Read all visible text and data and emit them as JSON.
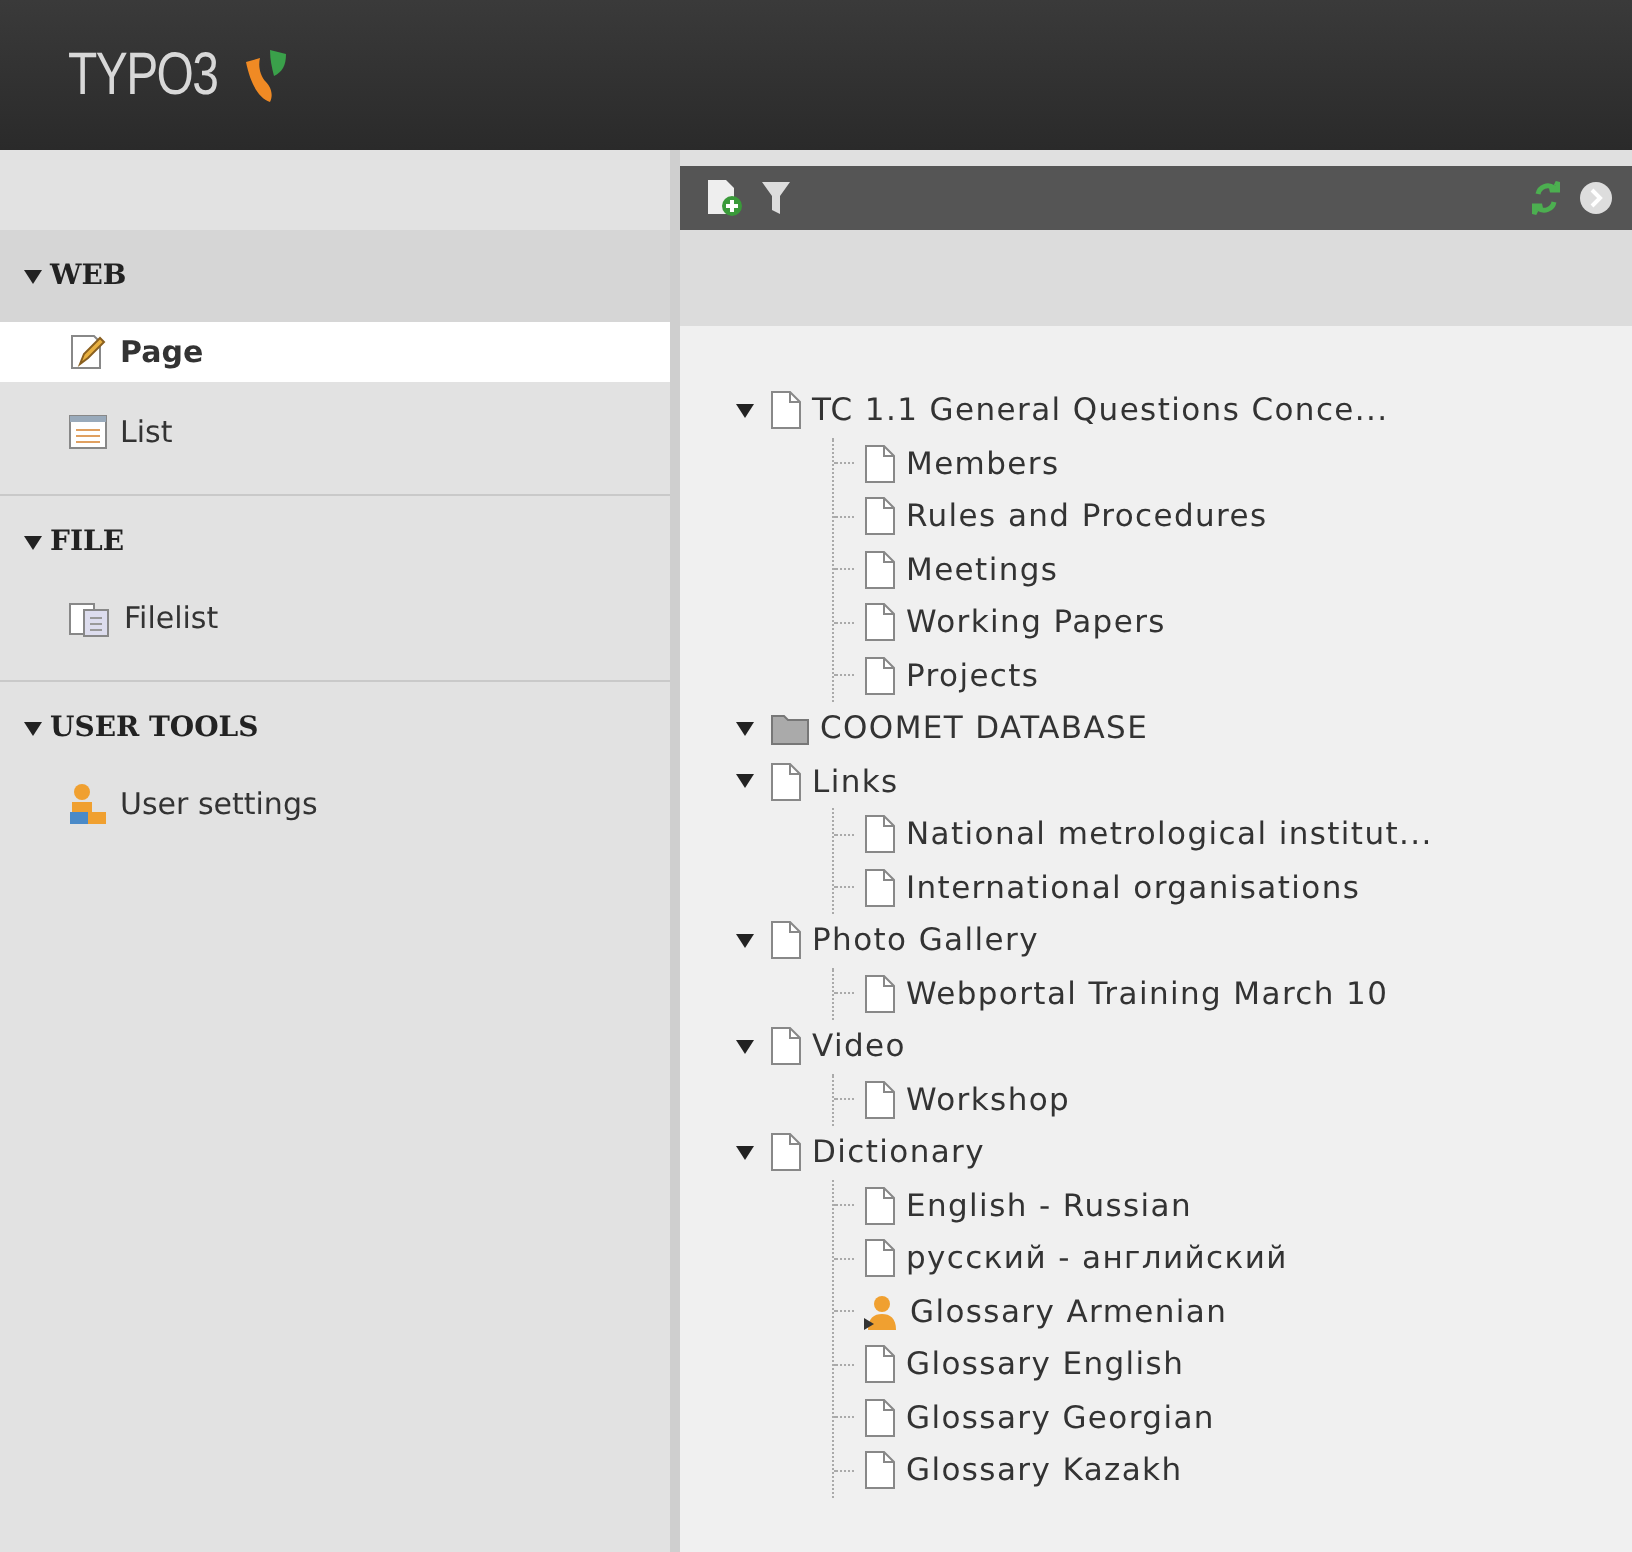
{
  "header": {
    "logo": "TYPO3"
  },
  "sidebar": {
    "groups": [
      {
        "title": "WEB",
        "expanded": true,
        "items": [
          {
            "label": "Page",
            "kind": "page-edit",
            "selected": true
          },
          {
            "label": "List",
            "kind": "list",
            "selected": false
          }
        ]
      },
      {
        "title": "FILE",
        "expanded": true,
        "items": [
          {
            "label": "Filelist",
            "kind": "filelist",
            "selected": false
          }
        ]
      },
      {
        "title": "USER TOOLS",
        "expanded": true,
        "items": [
          {
            "label": "User settings",
            "kind": "user",
            "selected": false
          }
        ]
      }
    ]
  },
  "tree": [
    {
      "label": "TC 1.1 General Questions Conce...",
      "kind": "page",
      "expanded": true,
      "children": [
        {
          "label": "Members",
          "kind": "page"
        },
        {
          "label": "Rules and Procedures",
          "kind": "page"
        },
        {
          "label": "Meetings",
          "kind": "page"
        },
        {
          "label": "Working Papers",
          "kind": "page"
        },
        {
          "label": "Projects",
          "kind": "page"
        }
      ]
    },
    {
      "label": "COOMET DATABASE",
      "kind": "folder",
      "expanded": true
    },
    {
      "label": "Links",
      "kind": "page",
      "expanded": true,
      "children": [
        {
          "label": "National metrological institut...",
          "kind": "page"
        },
        {
          "label": "International organisations",
          "kind": "page"
        }
      ]
    },
    {
      "label": "Photo Gallery",
      "kind": "page",
      "expanded": true,
      "children": [
        {
          "label": "Webportal Training March 10",
          "kind": "page"
        }
      ]
    },
    {
      "label": "Video",
      "kind": "page",
      "expanded": true,
      "children": [
        {
          "label": "Workshop",
          "kind": "page"
        }
      ]
    },
    {
      "label": "Dictionary",
      "kind": "page",
      "expanded": true,
      "children": [
        {
          "label": "English - Russian",
          "kind": "page"
        },
        {
          "label": "русский - английский",
          "kind": "page"
        },
        {
          "label": "Glossary Armenian",
          "kind": "user"
        },
        {
          "label": "Glossary English",
          "kind": "page"
        },
        {
          "label": "Glossary Georgian",
          "kind": "page"
        },
        {
          "label": "Glossary Kazakh",
          "kind": "page"
        }
      ]
    }
  ]
}
